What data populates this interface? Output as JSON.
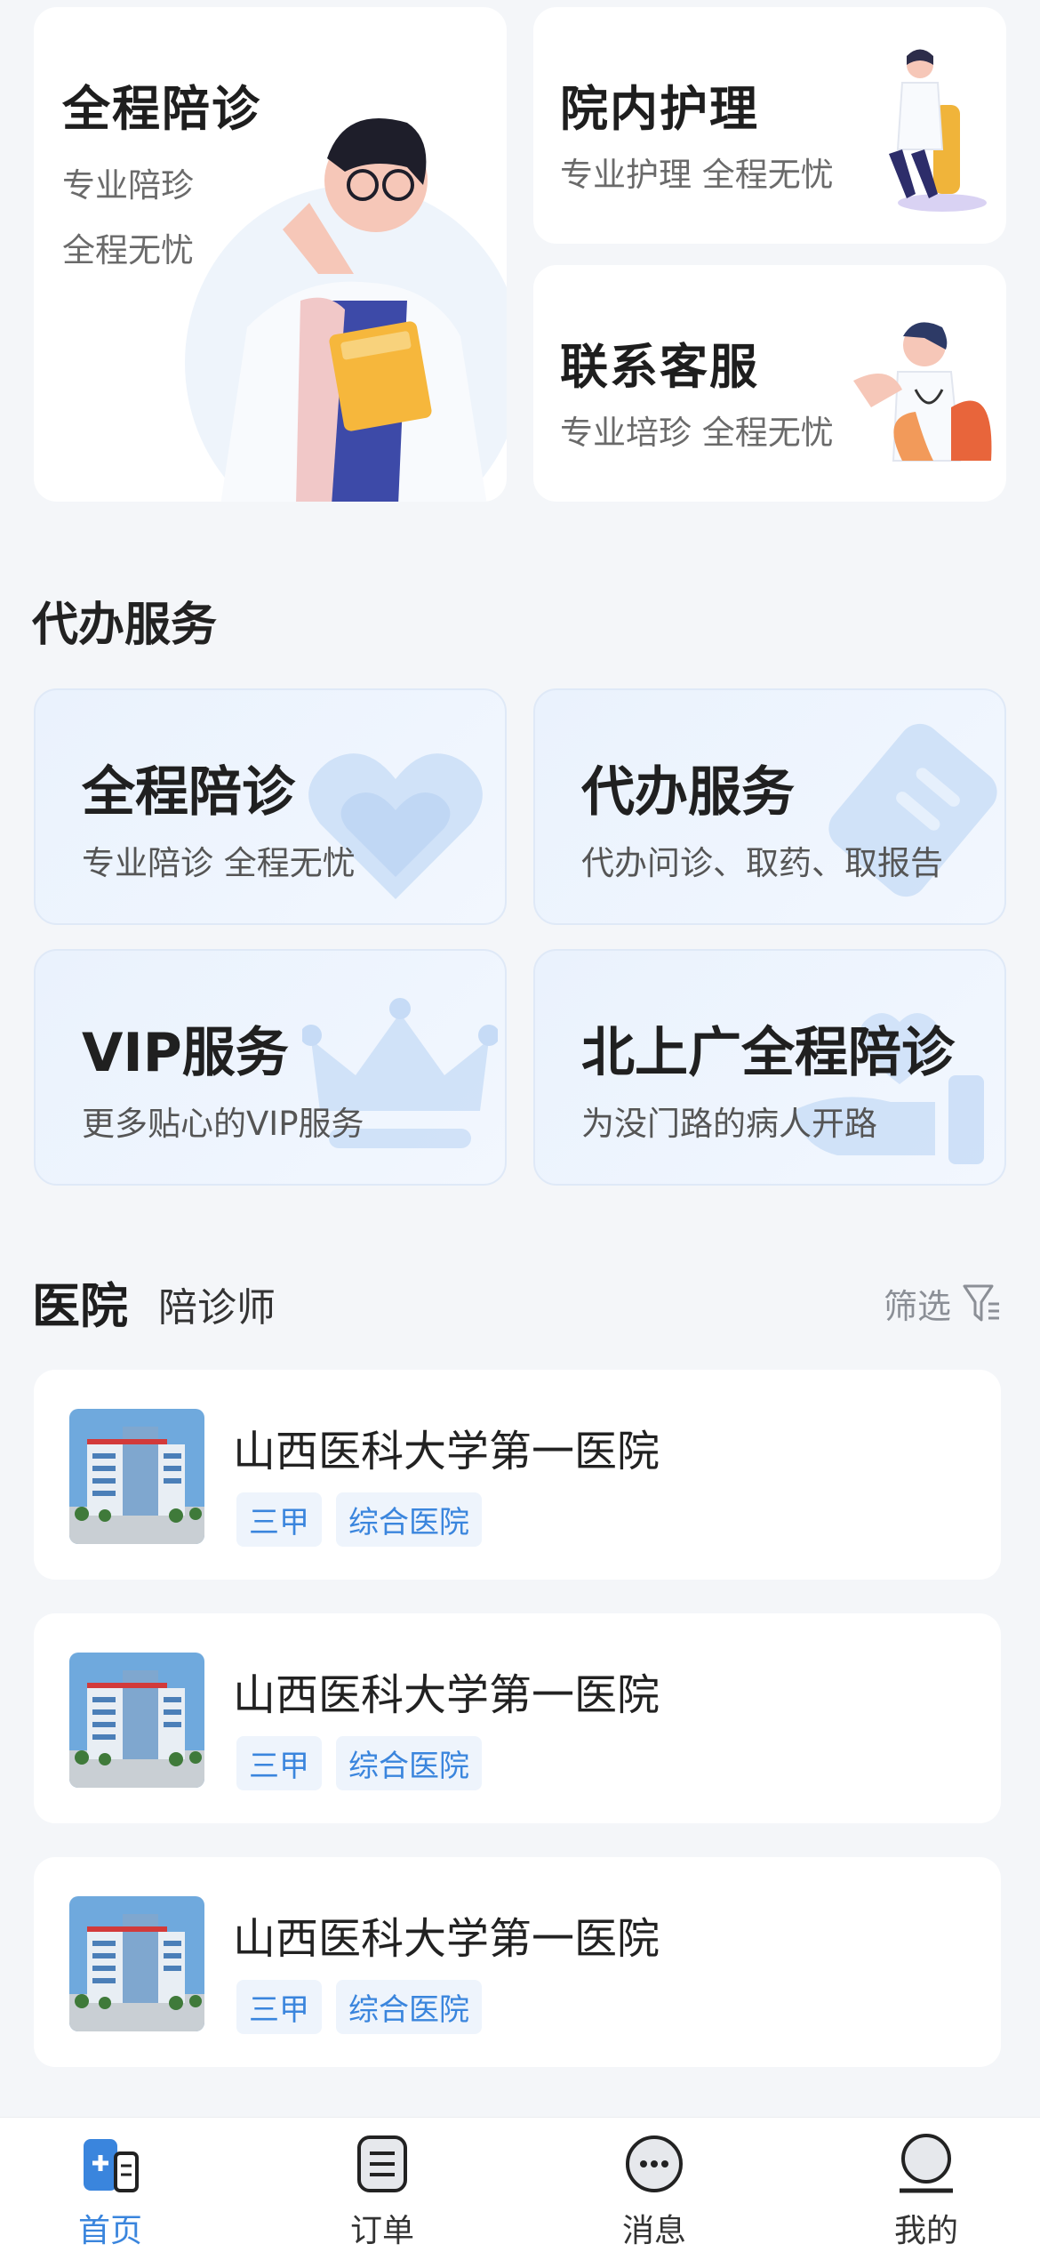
{
  "top_cards": {
    "escort": {
      "title": "全程陪诊",
      "sub1": "专业陪珍",
      "sub2": "全程无忧"
    },
    "nursing": {
      "title": "院内护理",
      "sub": "专业护理   全程无忧"
    },
    "service": {
      "title": "联系客服",
      "sub": "专业培珍   全程无忧"
    }
  },
  "agency_section": {
    "title": "代办服务"
  },
  "services": [
    {
      "title": "全程陪诊",
      "sub": "专业陪诊   全程无忧",
      "icon": "heart-icon"
    },
    {
      "title": "代办服务",
      "sub": "代办问诊、取药、取报告",
      "icon": "document-icon"
    },
    {
      "title": "VIP服务",
      "sub": "更多贴心的VIP服务",
      "icon": "crown-icon"
    },
    {
      "title": "北上广全程陪诊",
      "sub": "为没门路的病人开路",
      "icon": "hand-icon"
    }
  ],
  "hospital_section": {
    "title": "医院",
    "tab2": "陪诊师",
    "filter_label": "筛选"
  },
  "hospitals": [
    {
      "name": "山西医科大学第一医院",
      "tags": [
        "三甲",
        "综合医院"
      ]
    },
    {
      "name": "山西医科大学第一医院",
      "tags": [
        "三甲",
        "综合医院"
      ]
    },
    {
      "name": "山西医科大学第一医院",
      "tags": [
        "三甲",
        "综合医院"
      ]
    }
  ],
  "tabbar": {
    "home": "首页",
    "orders": "订单",
    "messages": "消息",
    "mine": "我的"
  },
  "colors": {
    "accent": "#3a85dd",
    "background": "#f4f6f9"
  }
}
